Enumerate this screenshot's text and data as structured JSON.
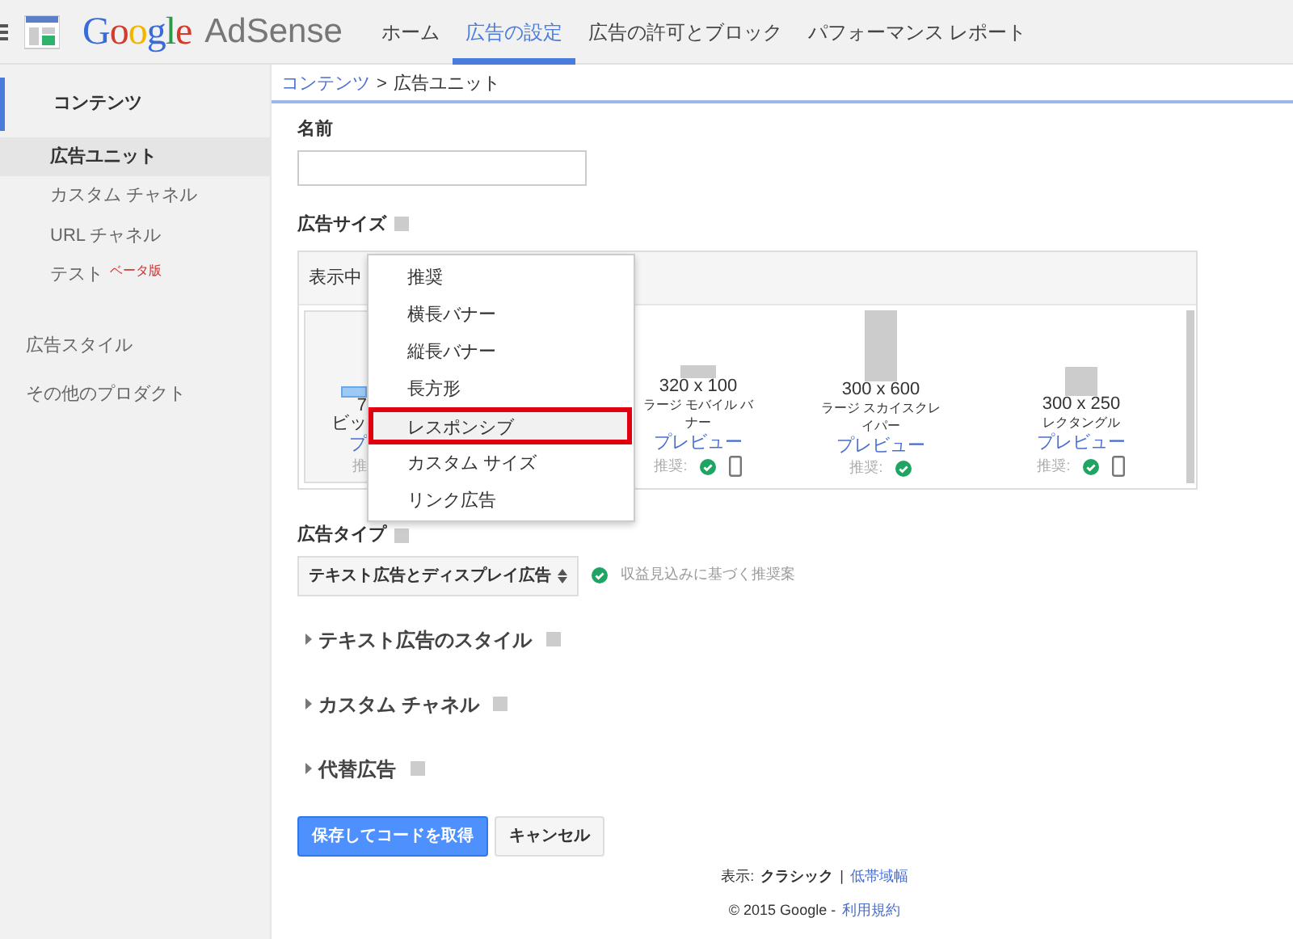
{
  "header": {
    "logo": {
      "brand": "Google",
      "product": "AdSense"
    },
    "nav": [
      {
        "label": "ホーム",
        "selected": false
      },
      {
        "label": "広告の設定",
        "selected": true
      },
      {
        "label": "広告の許可とブロック",
        "selected": false
      },
      {
        "label": "パフォーマンス レポート",
        "selected": false
      }
    ]
  },
  "sidebar": {
    "items": [
      {
        "label": "コンテンツ",
        "selected": true,
        "children": [
          {
            "label": "広告ユニット",
            "selected": true
          },
          {
            "label": "カスタム チャネル",
            "selected": false
          },
          {
            "label": "URL チャネル",
            "selected": false
          },
          {
            "label": "テスト",
            "selected": false,
            "badge": "ベータ版"
          }
        ]
      },
      {
        "label": "広告スタイル",
        "selected": false
      },
      {
        "label": "その他のプロダクト",
        "selected": false
      }
    ]
  },
  "breadcrumb": [
    {
      "label": "コンテンツ",
      "kind": "link"
    },
    {
      "label": ">",
      "kind": "separator"
    },
    {
      "label": "広告ユニット",
      "kind": "current"
    }
  ],
  "name_field": {
    "label": "名前"
  },
  "ad_size": {
    "label": "広告サイズ",
    "filter_label": "表示中",
    "menu": [
      {
        "label": "推奨",
        "selected": false
      },
      {
        "label": "横長バナー",
        "selected": false
      },
      {
        "label": "縦長バナー",
        "selected": false
      },
      {
        "label": "長方形",
        "selected": false
      },
      {
        "label": "レスポンシブ",
        "selected": true
      },
      {
        "label": "カスタム サイズ",
        "selected": false
      },
      {
        "label": "リンク広告",
        "selected": false
      }
    ],
    "cards": [
      {
        "kind": "leaderboard",
        "selected": true,
        "size": "7",
        "name": "ビッ",
        "preview": "プ",
        "recommended_label": "推"
      },
      {
        "kind": "mobile-banner",
        "selected": false,
        "size": "320 x 100",
        "name": "ラージ モバイル バナー",
        "preview": "プレビュー",
        "recommended_label": "推奨:",
        "recommended": true,
        "mobile": true
      },
      {
        "kind": "skyscraper",
        "selected": false,
        "size": "300 x 600",
        "name": "ラージ スカイスクレイパー",
        "preview": "プレビュー",
        "recommended_label": "推奨:",
        "recommended": true,
        "mobile": false
      },
      {
        "kind": "rectangle",
        "selected": false,
        "size": "300 x 250",
        "name": "レクタングル",
        "preview": "プレビュー",
        "recommended_label": "推奨:",
        "recommended": true,
        "mobile": true
      }
    ]
  },
  "ad_type": {
    "label": "広告タイプ",
    "value": "テキスト広告とディスプレイ広告",
    "hint": "収益見込みに基づく推奨案"
  },
  "sections": [
    {
      "label": "テキスト広告のスタイル",
      "expanded": false
    },
    {
      "label": "カスタム チャネル",
      "expanded": false
    },
    {
      "label": "代替広告",
      "expanded": false
    }
  ],
  "buttons": [
    {
      "label": "保存してコードを取得",
      "kind": "primary"
    },
    {
      "label": "キャンセル",
      "kind": "secondary"
    }
  ],
  "footer": {
    "view_label": "表示:",
    "view_current": "クラシック",
    "view_separator": "|",
    "view_alt": "低帯域幅",
    "copyright": "© 2015 Google -",
    "terms": "利用規約"
  }
}
